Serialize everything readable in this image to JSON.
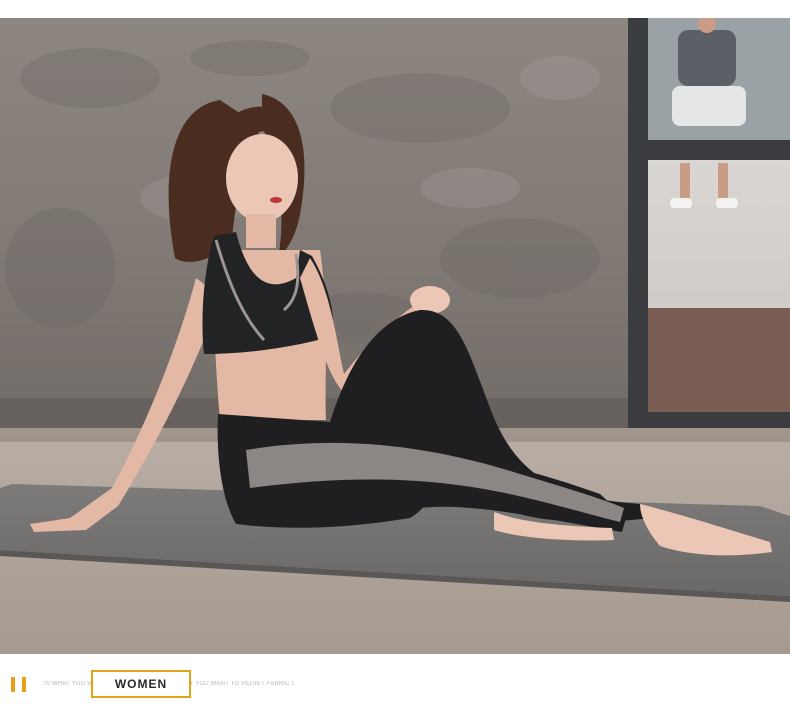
{
  "photo": {
    "subject": "woman-in-sportswear-on-yoga-mat"
  },
  "footer": {
    "tagline": "IS WHAT YOU WANT TO VELVET FABRIC IS WHAT YOU WANT TO VELVET FABRIC IS WHAT YO",
    "word": "WOMEN",
    "accent_color": "#e3a21a"
  }
}
